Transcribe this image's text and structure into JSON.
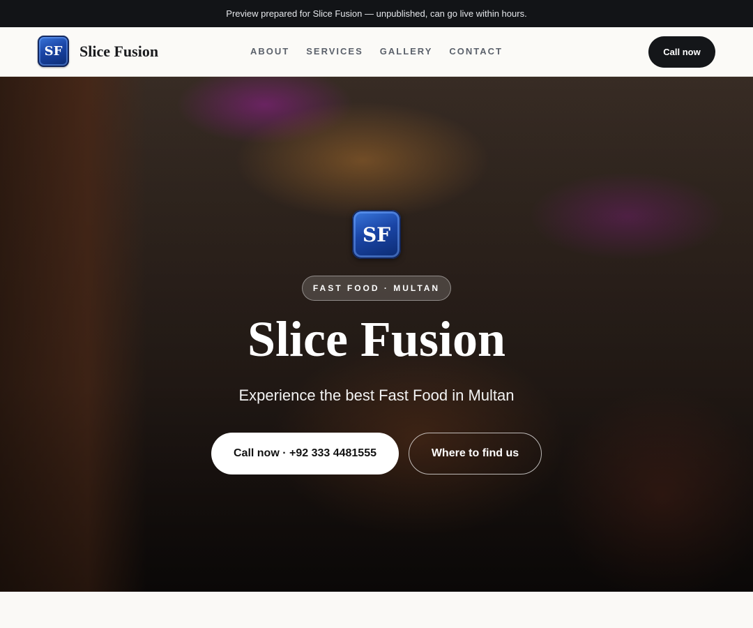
{
  "announcement": "Preview prepared for Slice Fusion — unpublished, can go live within hours.",
  "brand": {
    "logo_text": "SF",
    "name": "Slice Fusion",
    "logo_color": "#1a45a6"
  },
  "nav": {
    "links": [
      "ABOUT",
      "SERVICES",
      "GALLERY",
      "CONTACT"
    ],
    "cta_label": "Call now"
  },
  "hero": {
    "logo_text": "SF",
    "tagline": "FAST FOOD · MULTAN",
    "title": "Slice Fusion",
    "subtitle": "Experience the best Fast Food in Multan",
    "primary_button": "Call now · +92 333 4481555",
    "secondary_button": "Where to find us"
  },
  "colors": {
    "topbar_bg": "#121417",
    "dark_button": "#141619",
    "page_bg": "#faf9f6"
  }
}
